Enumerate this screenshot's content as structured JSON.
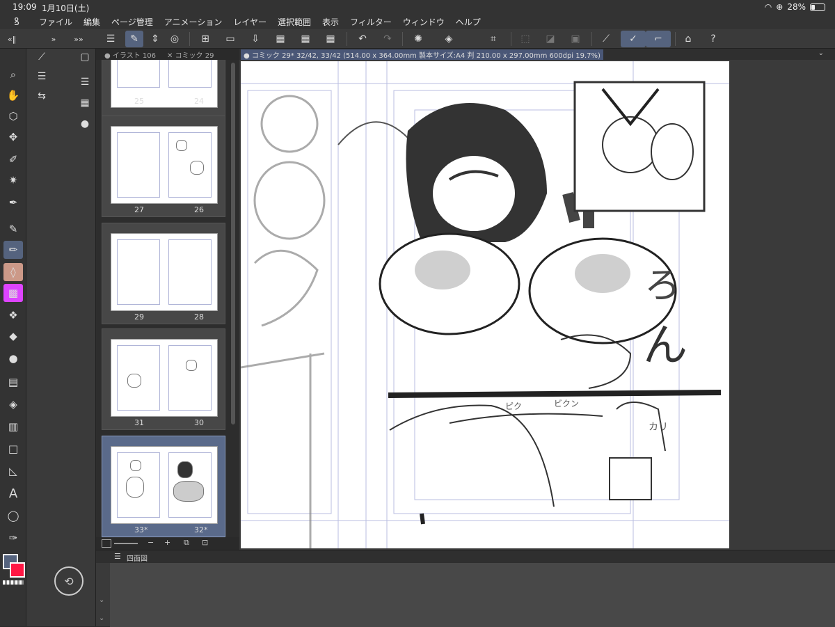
{
  "status": {
    "time": "19:09",
    "date": "1月10日(土)",
    "battery": "28%"
  },
  "menu": [
    "ファイル",
    "編集",
    "ページ管理",
    "アニメーション",
    "レイヤー",
    "選択範囲",
    "表示",
    "フィルター",
    "ウィンドウ",
    "ヘルプ"
  ],
  "tabs": {
    "left1": "イラスト 106",
    "left2": "コミック 29",
    "doc": "コミック 29* 32/42, 33/42 (514.00 x 364.00mm 製本サイズ:A4 判 210.00 x 297.00mm 600dpi 19.7%)"
  },
  "pages": [
    {
      "left": "25",
      "right": "24"
    },
    {
      "left": "27",
      "right": "26"
    },
    {
      "left": "29",
      "right": "28"
    },
    {
      "left": "31",
      "right": "30"
    },
    {
      "left": "33*",
      "right": "32*"
    }
  ],
  "bottom_panel": {
    "title": "四面図"
  },
  "colors": {
    "main": "#55637e",
    "sub": "#ff1744"
  }
}
